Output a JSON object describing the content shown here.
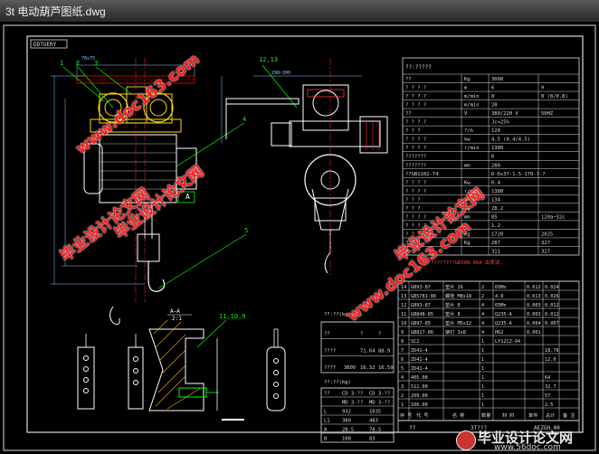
{
  "window": {
    "title": "3t 电动葫芦图纸.dwg"
  },
  "watermarks": {
    "site1": "www.doc163.com",
    "site2": "www.doc163.com",
    "brand1": "毕业设计论文网",
    "brand2": "毕业设计论文网",
    "brand3": "毕业设计论文网"
  },
  "logo": {
    "cn": "毕业设计论文网",
    "url": "www.56doc.com"
  },
  "drawing": {
    "corner_tag": "DDTUERY",
    "view_label_a": "A",
    "section_label": "A—A",
    "section_scale": "2:1",
    "callouts": [
      "1",
      "2",
      "3",
      "4",
      "5",
      "12,13",
      "11,10,9"
    ],
    "spec_title": "??:?????",
    "spec_rows": [
      [
        "??",
        "Kg",
        "3000"
      ],
      [
        "? ? ? ?",
        "m",
        "6",
        "9"
      ],
      [
        "? ? ? ?",
        "m/min",
        "8",
        "8 (8/0.8)"
      ],
      [
        "? ? ? ?",
        "m/min",
        "20",
        ""
      ],
      [
        "??",
        "V",
        "380/220 V",
        "50HZ"
      ],
      [
        "? ? ? ?",
        "",
        "Jc=25%",
        ""
      ],
      [
        "? ? ?",
        "?/h",
        "120",
        ""
      ],
      [
        "? ? ? ?",
        "kw",
        "4.5 (0.4/4.5)",
        ""
      ],
      [
        "? ? ? ?",
        "r/min",
        "1380",
        ""
      ],
      [
        "???????",
        "",
        "6",
        ""
      ],
      [
        "???????",
        "mm",
        "280",
        ""
      ],
      [
        "??GB1102-74",
        "",
        "D-6x37-1.5-170-?-?",
        ""
      ],
      [
        "? ? ? ?",
        "Kw",
        "0.4",
        ""
      ],
      [
        "? ? ? ?",
        "r/min",
        "1380",
        ""
      ],
      [
        "? ? ?",
        "mm",
        "134",
        ""
      ],
      [
        "? ? ?",
        "Kg",
        "28.2",
        ""
      ],
      [
        "? ? ? ?",
        "mm",
        "85",
        "120a~32c"
      ],
      [
        "? ? ? ?",
        "m",
        "1.2",
        ""
      ],
      [
        "? ? ?",
        "Kg",
        "1720",
        "2025"
      ],
      [
        "? ? ?",
        "Kg",
        "287",
        "327"
      ],
      [
        "? ? ?",
        "",
        "311",
        "327"
      ]
    ],
    "note": "三 三 ??????????GB308.06A 出来法.",
    "parts_rows": [
      [
        "GB93-87",
        "垫片 16",
        "2",
        "65Mn",
        "0.012",
        "0.024"
      ],
      [
        "GB5781-86",
        "螺栓 M8x18",
        "2",
        "4.8",
        "0.013",
        "0.026"
      ],
      [
        "GB93-87",
        "垫片 8",
        "4",
        "65Mn",
        "0.003",
        "0.012"
      ],
      [
        "GB848-85",
        "垫片 8",
        "4",
        "Q235-A",
        "0.003",
        "0.012"
      ],
      [
        "GB97-85",
        "垫片 M5x12",
        "4",
        "Q235-A",
        "0.004",
        "0.007"
      ],
      [
        "GB827-86",
        "铆钉 3x8",
        "4",
        "H62",
        "0.001",
        ""
      ],
      [
        "SC2",
        "",
        "1",
        "LY12CZ-94",
        "",
        ""
      ],
      [
        "ZD41-4",
        "",
        "1",
        "",
        "",
        "18.76"
      ],
      [
        "ZD41-4",
        "",
        "1",
        "",
        "",
        "12.0"
      ],
      [
        "ZD41-4",
        "",
        "1",
        "",
        "",
        ""
      ],
      [
        "405.00",
        "",
        "1",
        "",
        "",
        "64"
      ],
      [
        "512.00",
        "",
        "1",
        "",
        "",
        "32.7"
      ],
      [
        "209.00",
        "",
        "1",
        "",
        "",
        "57"
      ],
      [
        "106.00",
        "",
        "1",
        "",
        "",
        "2.5"
      ]
    ],
    "parts_header": [
      "序 号",
      "代 号",
      "名 称",
      "数量",
      "材 料",
      "单件",
      "总计",
      "备 注"
    ],
    "title_block": {
      "name": "3T???",
      "code": "AEZGH.00",
      "scale": "??"
    },
    "weight_title": "??:??(kg)",
    "weight_rows": [
      [
        "??",
        "?",
        "?"
      ],
      [
        "????",
        "71.64",
        "88.9"
      ],
      [
        "????",
        "360V",
        "16.32",
        "16.59"
      ]
    ],
    "size_title": "??:??(kg)",
    "size_rows": [
      [
        "??",
        "CD 3-??",
        "CD 3-??"
      ],
      [
        "",
        "MD 3-??",
        "MD 3-??"
      ],
      [
        "L",
        "932",
        "1035"
      ],
      [
        "L1",
        "380",
        "483"
      ],
      [
        "A",
        "28.5",
        "78.5"
      ],
      [
        "B",
        "108",
        "83"
      ]
    ],
    "dims": [
      "70x75",
      "290~300",
      "2900~",
      "1290",
      "1250",
      "235~",
      "??",
      "??"
    ]
  }
}
